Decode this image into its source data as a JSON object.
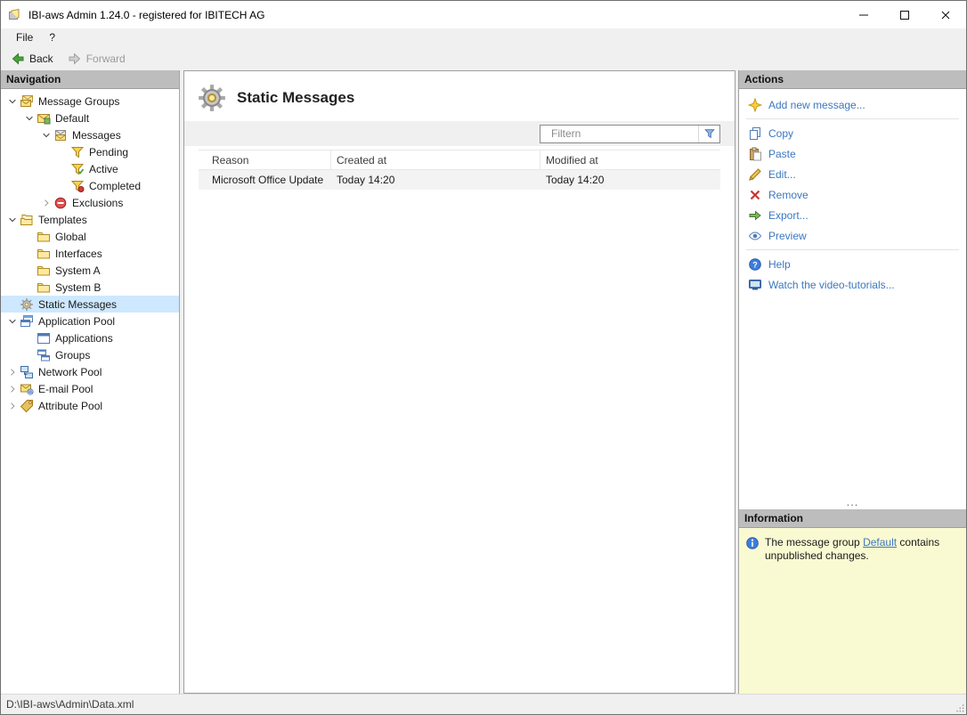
{
  "window": {
    "title": "IBI-aws Admin 1.24.0 - registered for IBITECH AG"
  },
  "colors": {
    "link_blue": "#3b78bf",
    "selection_blue": "#cde8ff",
    "info_bg": "#fafad2",
    "panel_header": "#bdbdbd"
  },
  "menubar": {
    "items": [
      {
        "label": "File"
      },
      {
        "label": "?"
      }
    ]
  },
  "toolbar": {
    "back_label": "Back",
    "forward_label": "Forward"
  },
  "navigation": {
    "header": "Navigation",
    "tree": [
      {
        "label": "Message Groups",
        "level": 0,
        "expander": "expanded",
        "icon": "message-groups-icon",
        "selected": false
      },
      {
        "label": "Default",
        "level": 1,
        "expander": "expanded",
        "icon": "default-group-icon",
        "selected": false
      },
      {
        "label": "Messages",
        "level": 2,
        "expander": "expanded",
        "icon": "messages-icon",
        "selected": false
      },
      {
        "label": "Pending",
        "level": 3,
        "expander": "none",
        "icon": "pending-icon",
        "selected": false
      },
      {
        "label": "Active",
        "level": 3,
        "expander": "none",
        "icon": "active-icon",
        "selected": false
      },
      {
        "label": "Completed",
        "level": 3,
        "expander": "none",
        "icon": "completed-icon",
        "selected": false
      },
      {
        "label": "Exclusions",
        "level": 2,
        "expander": "collapsed",
        "icon": "exclusions-icon",
        "selected": false
      },
      {
        "label": "Templates",
        "level": 0,
        "expander": "expanded",
        "icon": "templates-icon",
        "selected": false
      },
      {
        "label": "Global",
        "level": 1,
        "expander": "none",
        "icon": "folder-icon",
        "selected": false
      },
      {
        "label": "Interfaces",
        "level": 1,
        "expander": "none",
        "icon": "folder-icon",
        "selected": false
      },
      {
        "label": "System A",
        "level": 1,
        "expander": "none",
        "icon": "folder-icon",
        "selected": false
      },
      {
        "label": "System B",
        "level": 1,
        "expander": "none",
        "icon": "folder-icon",
        "selected": false
      },
      {
        "label": "Static Messages",
        "level": 0,
        "expander": "none",
        "icon": "static-messages-icon",
        "selected": true
      },
      {
        "label": "Application Pool",
        "level": 0,
        "expander": "expanded",
        "icon": "application-pool-icon",
        "selected": false
      },
      {
        "label": "Applications",
        "level": 1,
        "expander": "none",
        "icon": "applications-icon",
        "selected": false
      },
      {
        "label": "Groups",
        "level": 1,
        "expander": "none",
        "icon": "groups-icon",
        "selected": false
      },
      {
        "label": "Network Pool",
        "level": 0,
        "expander": "collapsed",
        "icon": "network-pool-icon",
        "selected": false
      },
      {
        "label": "E-mail Pool",
        "level": 0,
        "expander": "collapsed",
        "icon": "email-pool-icon",
        "selected": false
      },
      {
        "label": "Attribute Pool",
        "level": 0,
        "expander": "collapsed",
        "icon": "attribute-pool-icon",
        "selected": false
      }
    ]
  },
  "main": {
    "title": "Static Messages",
    "filter": {
      "placeholder": "Filtern"
    },
    "table": {
      "columns": [
        {
          "label": "Reason"
        },
        {
          "label": "Created at"
        },
        {
          "label": "Modified at"
        }
      ],
      "rows": [
        {
          "cells": [
            "Microsoft Office Update",
            "Today 14:20",
            "Today 14:20"
          ]
        }
      ]
    }
  },
  "actions": {
    "header": "Actions",
    "items": [
      {
        "type": "link",
        "label": "Add new message...",
        "icon": "add-new-message-icon"
      },
      {
        "type": "separator"
      },
      {
        "type": "link",
        "label": "Copy",
        "icon": "copy-icon"
      },
      {
        "type": "link",
        "label": "Paste",
        "icon": "paste-icon"
      },
      {
        "type": "link",
        "label": "Edit...",
        "icon": "edit-icon"
      },
      {
        "type": "link",
        "label": "Remove",
        "icon": "remove-icon"
      },
      {
        "type": "link",
        "label": "Export...",
        "icon": "export-icon"
      },
      {
        "type": "link",
        "label": "Preview",
        "icon": "preview-icon"
      },
      {
        "type": "separator"
      },
      {
        "type": "link",
        "label": "Help",
        "icon": "help-icon"
      },
      {
        "type": "link",
        "label": "Watch the video-tutorials...",
        "icon": "video-tutorials-icon"
      }
    ],
    "overflow": "..."
  },
  "information": {
    "header": "Information",
    "text_before": "The message group ",
    "link_label": "Default",
    "text_after": " contains unpublished changes."
  },
  "statusbar": {
    "path": "D:\\IBI-aws\\Admin\\Data.xml"
  }
}
